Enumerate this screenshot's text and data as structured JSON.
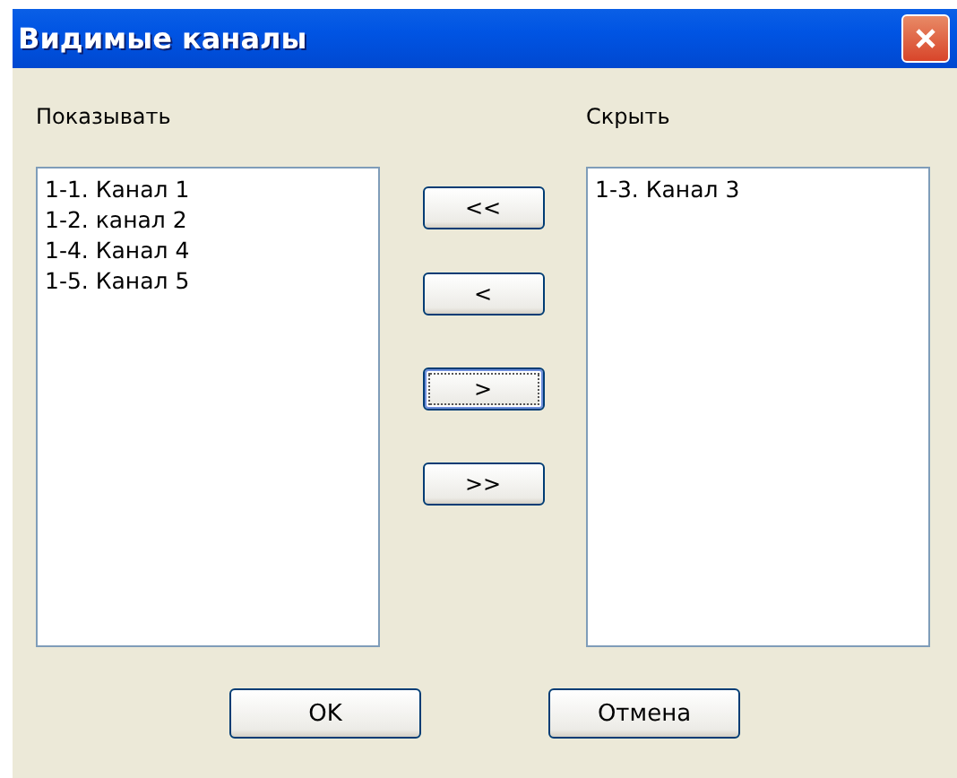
{
  "window": {
    "title": "Видимые каналы"
  },
  "show_list": {
    "label": "Показывать",
    "items": [
      "1-1. Канал 1",
      "1-2. канал 2",
      "1-4. Канал 4",
      "1-5. Канал 5"
    ]
  },
  "move_buttons": [
    {
      "label": "<<",
      "focused": false
    },
    {
      "label": "<",
      "focused": false
    },
    {
      "label": ">",
      "focused": true
    },
    {
      "label": ">>",
      "focused": false
    }
  ],
  "hide_list": {
    "label": "Скрыть",
    "items": [
      "1-3. Канал 3"
    ]
  },
  "buttons": [
    {
      "label": "OK",
      "focused": false
    },
    {
      "label": "Отмена",
      "focused": false
    }
  ]
}
